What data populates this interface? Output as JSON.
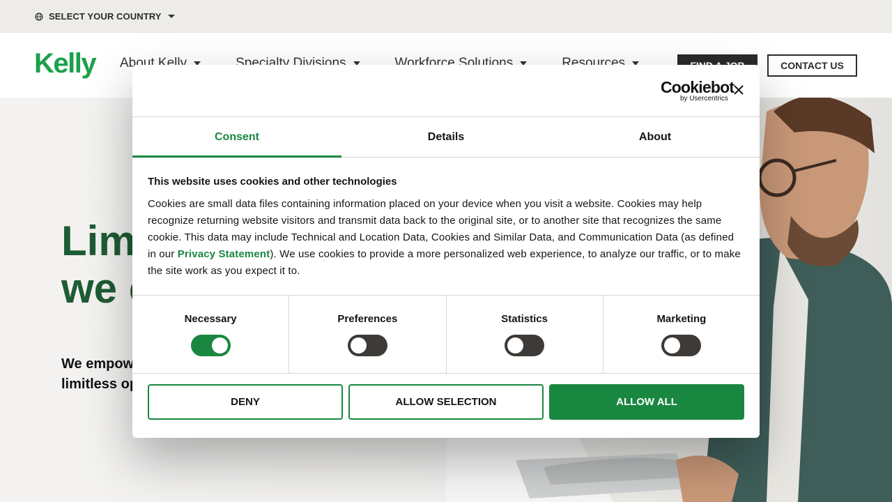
{
  "country_bar": {
    "label": "SELECT YOUR COUNTRY",
    "icon": "globe-icon"
  },
  "header": {
    "logo": "Kelly",
    "nav": [
      {
        "label": "About Kelly"
      },
      {
        "label": "Specialty Divisions"
      },
      {
        "label": "Workforce Solutions"
      },
      {
        "label": "Resources"
      }
    ],
    "find_job": "FIND A JOB",
    "contact": "CONTACT US"
  },
  "hero": {
    "title": "Limi\nwe c",
    "subtitle": "We empow\nlimitless op"
  },
  "cookie_dialog": {
    "brand": "Cookiebot",
    "brand_sub": "by Usercentrics",
    "tabs": [
      "Consent",
      "Details",
      "About"
    ],
    "active_tab": "Consent",
    "title": "This website uses cookies and other technologies",
    "para_before_link": "Cookies are small data files containing information placed on your device when you visit a website. Cookies may help recognize returning website visitors and transmit data back to the original site, or to another site that recognizes the same cookie. This data may include Technical and Location Data, Cookies and Similar Data, and Communication Data (as defined in our ",
    "link": "Privacy Statement",
    "para_after_link": "). We use cookies to provide a more personalized web experience, to analyze our traffic, or to make the site work as you expect it to.",
    "toggles": [
      {
        "label": "Necessary",
        "on": true
      },
      {
        "label": "Preferences",
        "on": false
      },
      {
        "label": "Statistics",
        "on": false
      },
      {
        "label": "Marketing",
        "on": false
      }
    ],
    "buttons": {
      "deny": "DENY",
      "allow_selection": "ALLOW SELECTION",
      "allow_all": "ALLOW ALL"
    }
  },
  "colors": {
    "brand_green": "#1aa14a",
    "accent_green": "#1a8741",
    "hero_title": "#1e5c35"
  }
}
